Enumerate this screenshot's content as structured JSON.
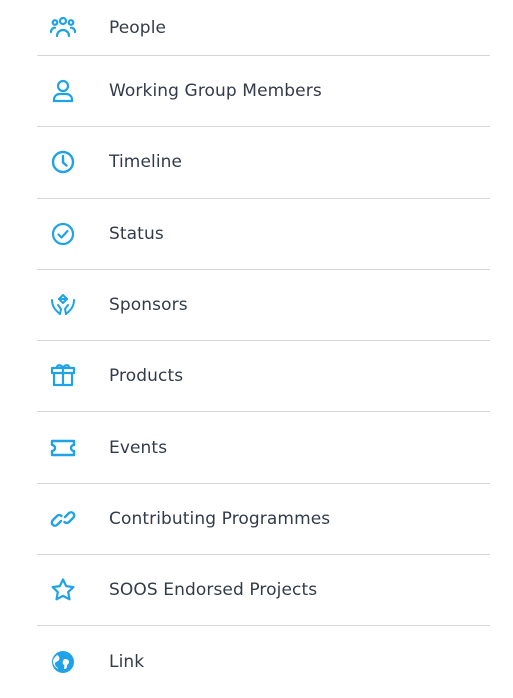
{
  "accent_color": "#1fa2e8",
  "menu": {
    "items": [
      {
        "label": "People",
        "icon": "people-icon"
      },
      {
        "label": "Working Group Members",
        "icon": "person-icon"
      },
      {
        "label": "Timeline",
        "icon": "clock-icon"
      },
      {
        "label": "Status",
        "icon": "check-circle-icon"
      },
      {
        "label": "Sponsors",
        "icon": "hands-diamond-icon"
      },
      {
        "label": "Products",
        "icon": "box-icon"
      },
      {
        "label": "Events",
        "icon": "ticket-icon"
      },
      {
        "label": "Contributing Programmes",
        "icon": "link-icon"
      },
      {
        "label": "SOOS Endorsed Projects",
        "icon": "star-icon"
      },
      {
        "label": "Link",
        "icon": "globe-icon"
      }
    ]
  }
}
